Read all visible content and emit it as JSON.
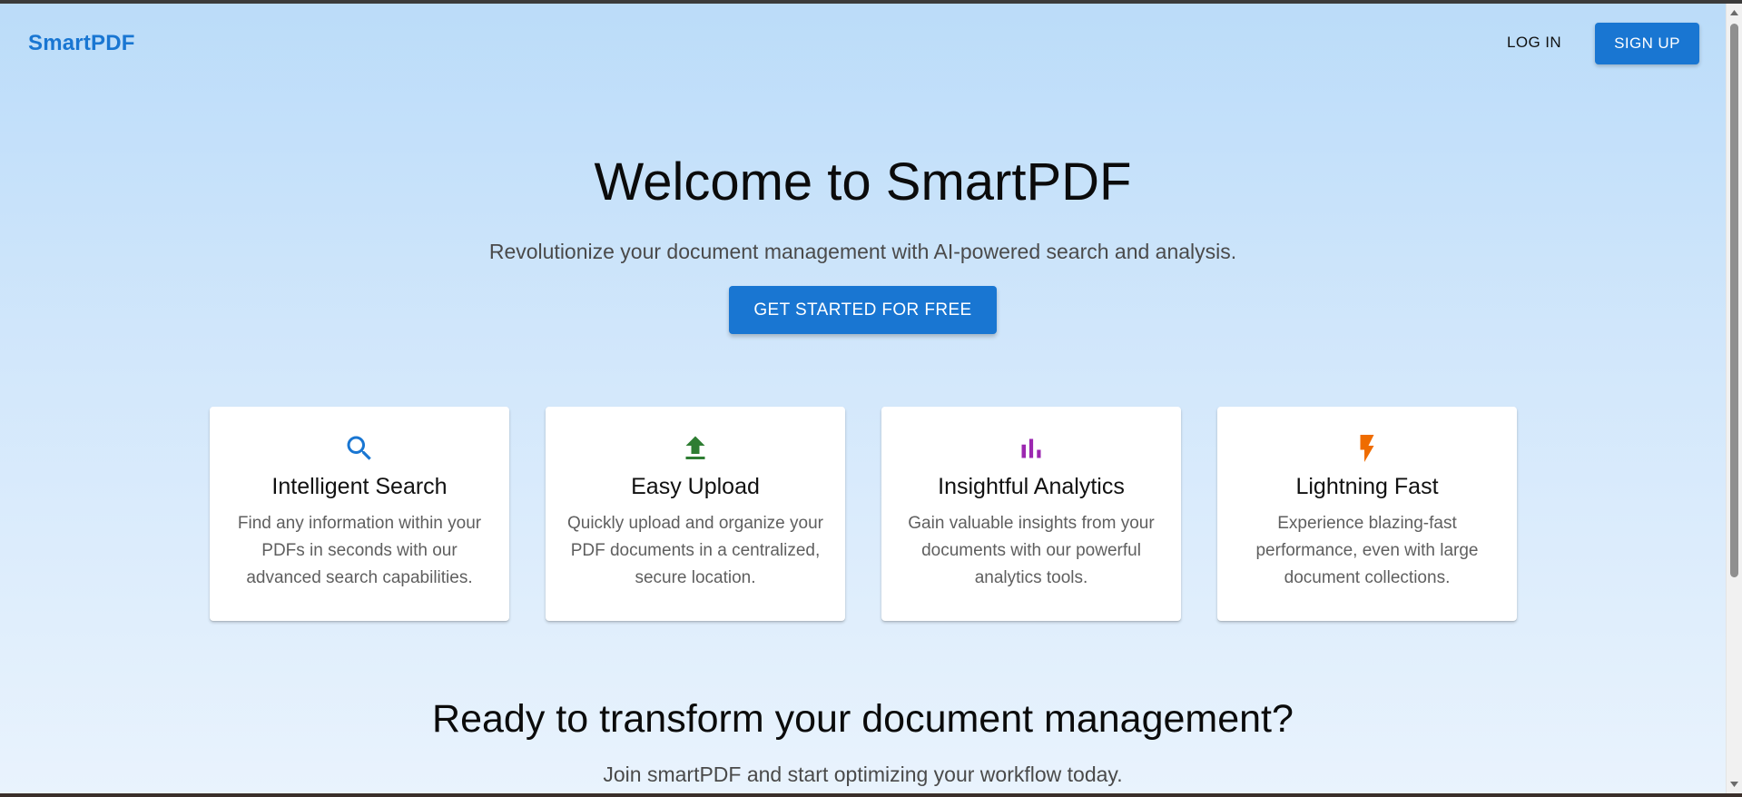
{
  "header": {
    "logo": "SmartPDF",
    "login_label": "LOG IN",
    "signup_label": "SIGN UP"
  },
  "hero": {
    "title": "Welcome to SmartPDF",
    "subtitle": "Revolutionize your document management with AI-powered search and analysis.",
    "cta_label": "GET STARTED FOR FREE"
  },
  "features": [
    {
      "icon": "search-icon",
      "title": "Intelligent Search",
      "description": "Find any information within your PDFs in seconds with our advanced search capabilities.",
      "color": "#1976d2"
    },
    {
      "icon": "upload-icon",
      "title": "Easy Upload",
      "description": "Quickly upload and organize your PDF documents in a centralized, secure location.",
      "color": "#2e7d32"
    },
    {
      "icon": "bar-chart-icon",
      "title": "Insightful Analytics",
      "description": "Gain valuable insights from your documents with our powerful analytics tools.",
      "color": "#9c27b0"
    },
    {
      "icon": "lightning-icon",
      "title": "Lightning Fast",
      "description": "Experience blazing-fast performance, even with large document collections.",
      "color": "#ef6c00"
    }
  ],
  "closing": {
    "title": "Ready to transform your document management?",
    "subtitle": "Join smartPDF and start optimizing your workflow today."
  },
  "colors": {
    "primary": "#1976d2",
    "background_top": "#bbdcf9",
    "background_bottom": "#e9f3fd"
  }
}
